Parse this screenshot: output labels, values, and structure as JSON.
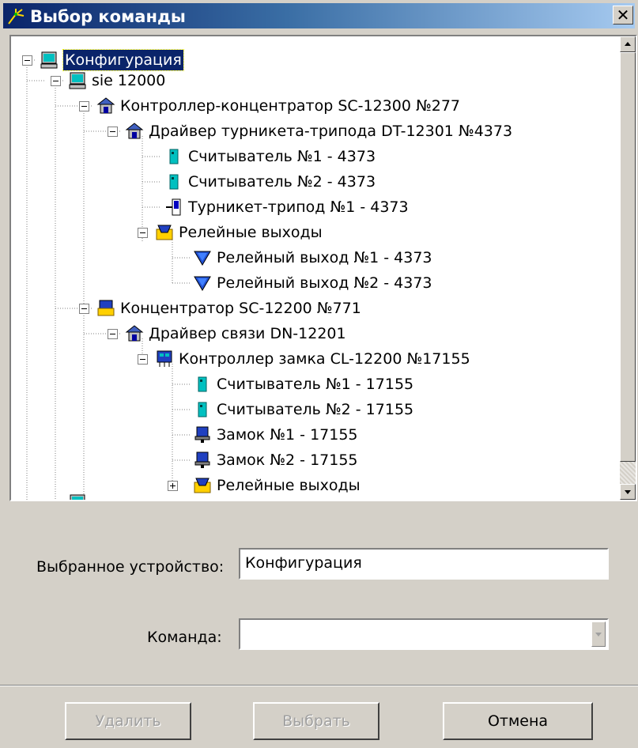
{
  "window": {
    "title": "Выбор команды",
    "close_glyph": "✕",
    "title_icon": "wand-icon"
  },
  "tree": {
    "nodes": [
      {
        "label": "Конфигурация",
        "icon": "computer-icon",
        "selected": true
      },
      {
        "label": "sie 12000",
        "icon": "computer-icon"
      },
      {
        "label": "Контроллер-концентратор SC-12300 №277",
        "icon": "controller-house-icon"
      },
      {
        "label": "Драйвер турникета-трипода DT-12301 №4373",
        "icon": "driver-house-icon"
      },
      {
        "label": "Считыватель №1 - 4373",
        "icon": "reader-icon"
      },
      {
        "label": "Считыватель №2 - 4373",
        "icon": "reader-icon"
      },
      {
        "label": "Турникет-трипод №1 - 4373",
        "icon": "turnstile-icon"
      },
      {
        "label": "Релейные выходы",
        "icon": "relay-folder-icon"
      },
      {
        "label": "Релейный выход №1 - 4373",
        "icon": "relay-output-icon"
      },
      {
        "label": "Релейный выход №2 - 4373",
        "icon": "relay-output-icon"
      },
      {
        "label": "Концентратор SC-12200 №771",
        "icon": "concentrator-icon"
      },
      {
        "label": "Драйвер связи DN-12201",
        "icon": "driver-house-icon"
      },
      {
        "label": "Контроллер замка CL-12200 №17155",
        "icon": "lock-controller-icon"
      },
      {
        "label": "Считыватель №1 - 17155",
        "icon": "reader-icon"
      },
      {
        "label": "Считыватель №2 - 17155",
        "icon": "reader-icon"
      },
      {
        "label": "Замок №1 - 17155",
        "icon": "lock-icon"
      },
      {
        "label": "Замок №2 - 17155",
        "icon": "lock-icon"
      },
      {
        "label": "Релейные выходы",
        "icon": "relay-folder-icon"
      }
    ]
  },
  "form": {
    "device_label": "Выбранное устройство:",
    "device_value": "Конфигурация",
    "command_label": "Команда:",
    "command_value": ""
  },
  "buttons": {
    "delete": "Удалить",
    "select": "Выбрать",
    "cancel": "Отмена"
  },
  "colors": {
    "title_start": "#0a246a",
    "title_end": "#a6caf0",
    "selection": "#0a246a",
    "face": "#d4d0c8"
  }
}
